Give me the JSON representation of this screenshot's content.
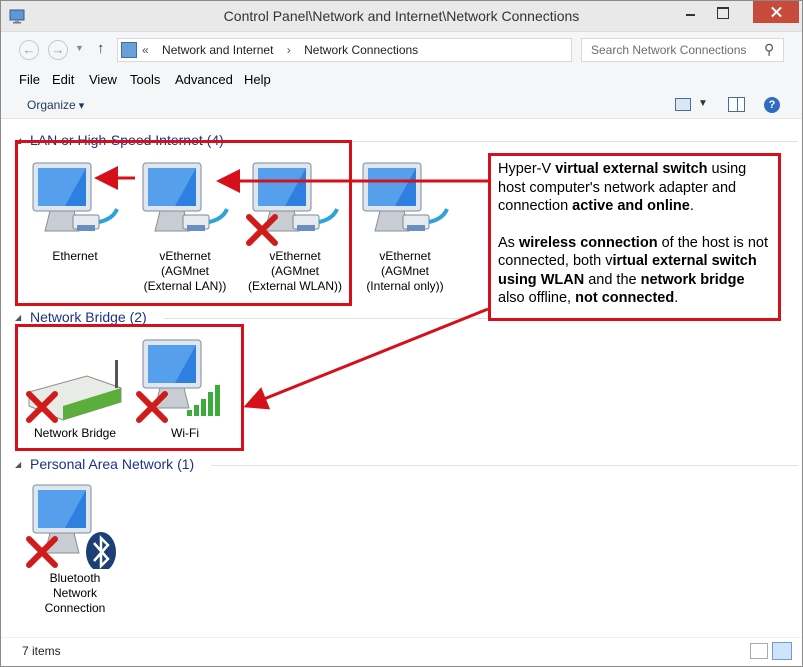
{
  "window": {
    "title": "Control Panel\\Network and Internet\\Network Connections"
  },
  "address": {
    "prefix": "«",
    "crumbs": [
      "Network and Internet",
      "›",
      "Network Connections"
    ],
    "search_placeholder": "Search Network Connections"
  },
  "menu": [
    "File",
    "Edit",
    "View",
    "Tools",
    "Advanced",
    "Help"
  ],
  "command_bar": {
    "organize": "Organize"
  },
  "groups": [
    {
      "header": "LAN or High-Speed Internet (4)",
      "items": [
        {
          "label": "Ethernet",
          "icon": "computer-network-icon",
          "disabled": false
        },
        {
          "label": "vEthernet\n(AGMnet\n(External LAN))",
          "icon": "computer-network-icon",
          "disabled": false
        },
        {
          "label": "vEthernet\n(AGMnet\n(External WLAN))",
          "icon": "computer-network-icon",
          "disabled": true
        },
        {
          "label": "vEthernet\n(AGMnet\n(Internal only))",
          "icon": "computer-network-icon",
          "disabled": false
        }
      ]
    },
    {
      "header": "Network Bridge (2)",
      "items": [
        {
          "label": "Network Bridge",
          "icon": "network-bridge-icon",
          "disabled": true
        },
        {
          "label": "Wi-Fi",
          "icon": "wifi-computer-icon",
          "disabled": true
        }
      ]
    },
    {
      "header": "Personal Area Network (1)",
      "items": [
        {
          "label": "Bluetooth\nNetwork\nConnection",
          "icon": "bluetooth-computer-icon",
          "disabled": true
        }
      ]
    }
  ],
  "callout": {
    "p1": [
      {
        "t": "Hyper-V ",
        "b": false
      },
      {
        "t": "virtual external switch",
        "b": true
      },
      {
        "t": " using host computer's network adapter and connection ",
        "b": false
      },
      {
        "t": "active and online",
        "b": true
      },
      {
        "t": ".",
        "b": false
      }
    ],
    "p2": [
      {
        "t": "As ",
        "b": false
      },
      {
        "t": "wireless connection",
        "b": true
      },
      {
        "t": " of the host is not connected, both v",
        "b": false
      },
      {
        "t": "irtual external switch using WLAN",
        "b": true
      },
      {
        "t": " and the ",
        "b": false
      },
      {
        "t": "network bridge",
        "b": true
      },
      {
        "t": " also offline, ",
        "b": false
      },
      {
        "t": "not connected",
        "b": true
      },
      {
        "t": ".",
        "b": false
      }
    ]
  },
  "status": {
    "items_count": "7 items"
  },
  "colors": {
    "annotation_red": "#d6101a",
    "group_header_blue": "#1e3287",
    "close_button": "#c74a3b"
  }
}
